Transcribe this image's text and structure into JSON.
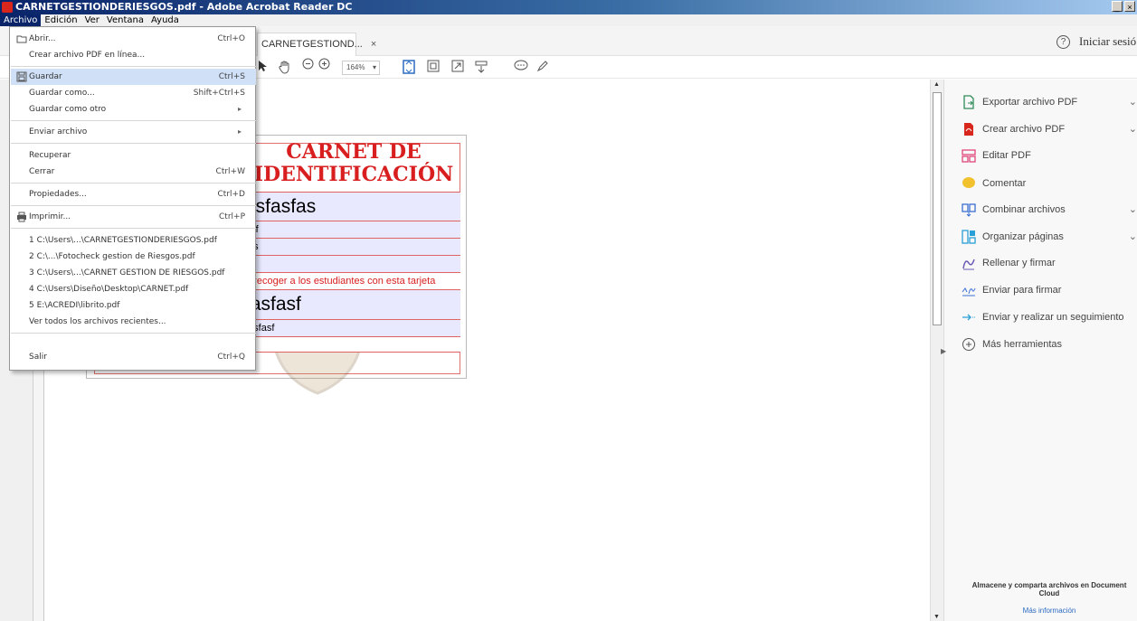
{
  "window": {
    "title": "CARNETGESTIONDERIESGOS.pdf - Adobe Acrobat Reader DC",
    "controls": [
      "_",
      "×"
    ]
  },
  "menubar": [
    "Archivo",
    "Edición",
    "Ver",
    "Ventana",
    "Ayuda"
  ],
  "tabs": {
    "doc_tab": "CARNETGESTIOND...",
    "close": "×"
  },
  "header": {
    "signin": "Iniciar sesió",
    "help": "?"
  },
  "toolbar": {
    "zoom": "164%"
  },
  "file_menu": {
    "items": [
      {
        "label": "Abrir...",
        "shortcut": "Ctrl+O"
      },
      {
        "label": "Crear archivo PDF en línea...",
        "shortcut": ""
      },
      {
        "label": "Guardar",
        "shortcut": "Ctrl+S"
      },
      {
        "label": "Guardar como...",
        "shortcut": "Shift+Ctrl+S"
      },
      {
        "label": "Guardar como otro",
        "shortcut": "▸"
      },
      {
        "label": "Enviar archivo",
        "shortcut": "▸"
      },
      {
        "label": "Recuperar",
        "shortcut": ""
      },
      {
        "label": "Cerrar",
        "shortcut": "Ctrl+W"
      },
      {
        "label": "Propiedades...",
        "shortcut": "Ctrl+D"
      },
      {
        "label": "Imprimir...",
        "shortcut": "Ctrl+P"
      },
      {
        "label": "1 C:\\Users\\...\\CARNETGESTIONDERIESGOS.pdf",
        "shortcut": ""
      },
      {
        "label": "2 C:\\...\\Fotocheck gestion de Riesgos.pdf",
        "shortcut": ""
      },
      {
        "label": "3 C:\\Users\\...\\CARNET GESTION DE RIESGOS.pdf",
        "shortcut": ""
      },
      {
        "label": "4 C:\\Users\\Diseño\\Desktop\\CARNET.pdf",
        "shortcut": ""
      },
      {
        "label": "5 E:\\ACREDI\\librito.pdf",
        "shortcut": ""
      },
      {
        "label": "Ver todos los archivos recientes...",
        "shortcut": ""
      },
      {
        "label": "Salir",
        "shortcut": "Ctrl+Q"
      }
    ]
  },
  "card": {
    "title_line1": "CARNET DE",
    "title_line2": "IDENTIFICACIÓN",
    "rows": [
      "asfasfas",
      "asf",
      "fas",
      "as",
      "a recoger a los estudiantes con esta tarjeta",
      "fasfasf",
      "fasfasf"
    ]
  },
  "tools_panel": {
    "items": [
      {
        "label": "Exportar archivo PDF",
        "chevron": "⌄",
        "icon": "export-pdf-icon",
        "color": "#2e8b57"
      },
      {
        "label": "Crear archivo PDF",
        "chevron": "⌄",
        "icon": "create-pdf-icon",
        "color": "#d9261c"
      },
      {
        "label": "Editar PDF",
        "chevron": "",
        "icon": "edit-pdf-icon",
        "color": "#e0457b"
      },
      {
        "label": "Comentar",
        "chevron": "",
        "icon": "comment-icon",
        "color": "#f2c12e"
      },
      {
        "label": "Combinar archivos",
        "chevron": "⌄",
        "icon": "combine-files-icon",
        "color": "#3b6fd4"
      },
      {
        "label": "Organizar páginas",
        "chevron": "⌄",
        "icon": "organize-pages-icon",
        "color": "#2a9fd8"
      },
      {
        "label": "Rellenar y firmar",
        "chevron": "",
        "icon": "fill-sign-icon",
        "color": "#6e5ab5"
      },
      {
        "label": "Enviar para firmar",
        "chevron": "",
        "icon": "send-sign-icon",
        "color": "#3b6fd4"
      },
      {
        "label": "Enviar y realizar un seguimiento",
        "chevron": "",
        "icon": "send-track-icon",
        "color": "#2a9fd8"
      },
      {
        "label": "Más herramientas",
        "chevron": "",
        "icon": "more-tools-icon",
        "color": "#555555"
      }
    ],
    "promo": "Almacene y comparta archivos en Document Cloud",
    "promo_link": "Más información"
  }
}
